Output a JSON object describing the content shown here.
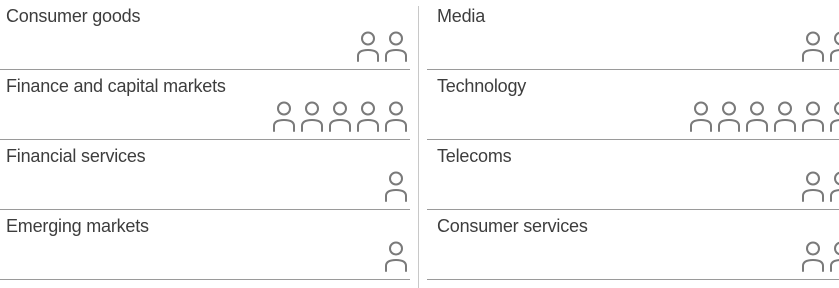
{
  "colors": {
    "icon": "#7a7a7a",
    "text": "#3d3d3d",
    "divider": "#9a9a9a"
  },
  "icon_name": "person-outline-icon",
  "sectors": [
    {
      "label": "Consumer goods",
      "people": 2
    },
    {
      "label": "Finance and capital markets",
      "people": 5
    },
    {
      "label": "Financial services",
      "people": 1
    },
    {
      "label": "Emerging markets",
      "people": 1
    },
    {
      "label": "Media",
      "people": 2
    },
    {
      "label": "Technology",
      "people": 6
    },
    {
      "label": "Telecoms",
      "people": 2
    },
    {
      "label": "Consumer services",
      "people": 2
    }
  ]
}
